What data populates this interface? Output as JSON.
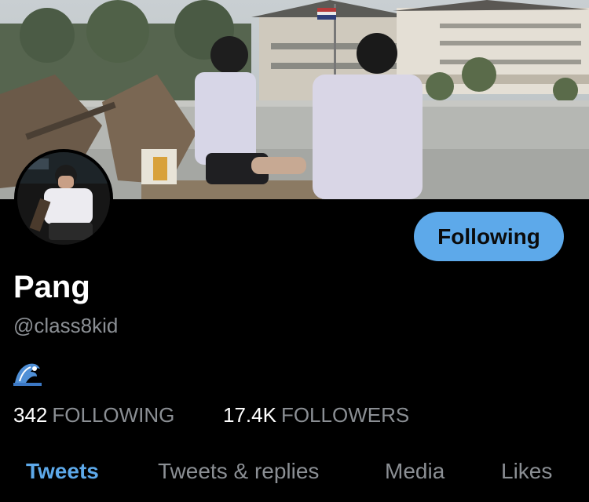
{
  "profile": {
    "name": "Pang",
    "handle": "@class8kid",
    "bio_emoji": "wave-emoji",
    "following_button_label": "Following"
  },
  "stats": {
    "following_count": "342",
    "following_label": "FOLLOWING",
    "followers_count": "17.4K",
    "followers_label": "FOLLOWERS"
  },
  "tabs": [
    {
      "label": "Tweets",
      "active": true
    },
    {
      "label": "Tweets & replies",
      "active": false
    },
    {
      "label": "Media",
      "active": false
    },
    {
      "label": "Likes",
      "active": false
    }
  ],
  "colors": {
    "accent": "#5da9ea",
    "background": "#000000",
    "secondary_text": "#8b8f94"
  }
}
